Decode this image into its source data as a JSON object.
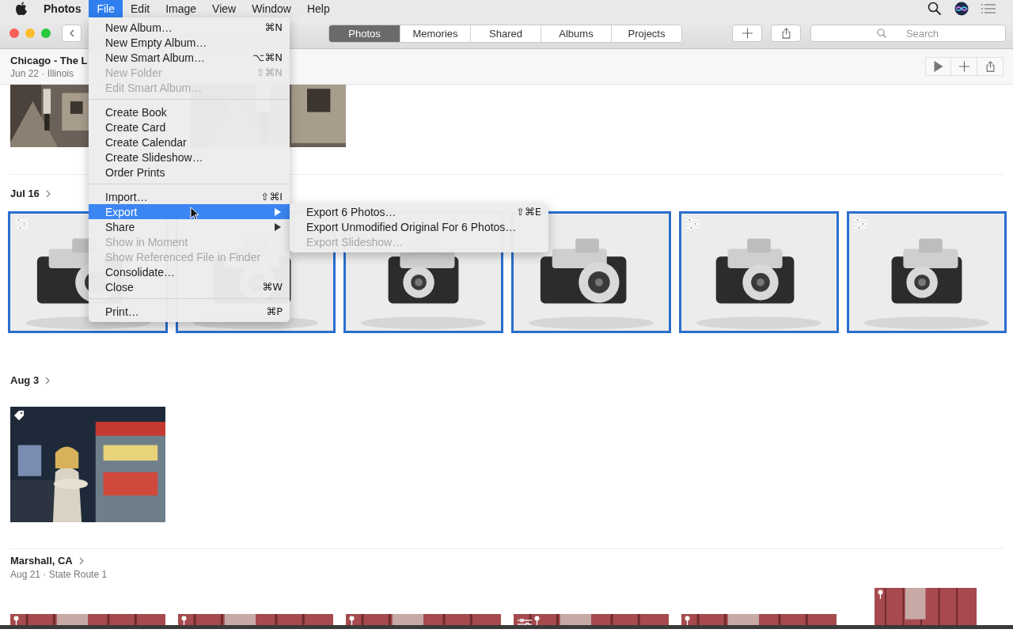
{
  "menu_bar": {
    "app_name": "Photos",
    "menus": [
      {
        "label": "File",
        "selected": true
      },
      {
        "label": "Edit",
        "selected": false
      },
      {
        "label": "Image",
        "selected": false
      },
      {
        "label": "View",
        "selected": false
      },
      {
        "label": "Window",
        "selected": false
      },
      {
        "label": "Help",
        "selected": false
      }
    ]
  },
  "toolbar": {
    "tabs": [
      {
        "label": "Photos",
        "selected": true
      },
      {
        "label": "Memories",
        "selected": false
      },
      {
        "label": "Shared",
        "selected": false
      },
      {
        "label": "Albums",
        "selected": false
      },
      {
        "label": "Projects",
        "selected": false
      }
    ],
    "search": {
      "placeholder": "Search"
    }
  },
  "header": {
    "title": "Chicago - The L",
    "subtitle": "Jun 22 · Illinois"
  },
  "top_strip": {
    "photos": [
      {
        "kind": "street",
        "selected": false
      },
      {
        "kind": "street",
        "selected": false
      }
    ]
  },
  "moments": [
    {
      "title": "Jul 16",
      "photos": [
        {
          "kind": "camera",
          "selected": true,
          "adjusted": true,
          "tagged": false,
          "pinned": false
        },
        {
          "kind": "camera",
          "selected": true,
          "adjusted": false,
          "tagged": false,
          "pinned": false
        },
        {
          "kind": "camera",
          "selected": true,
          "adjusted": false,
          "tagged": false,
          "pinned": false
        },
        {
          "kind": "camera",
          "selected": true,
          "adjusted": false,
          "tagged": false,
          "pinned": false
        },
        {
          "kind": "camera",
          "selected": true,
          "adjusted": true,
          "tagged": false,
          "pinned": false
        },
        {
          "kind": "camera",
          "selected": true,
          "adjusted": true,
          "tagged": false,
          "pinned": false
        }
      ]
    },
    {
      "title": "Aug 3",
      "photos": [
        {
          "kind": "market",
          "selected": false,
          "adjusted": false,
          "tagged": true,
          "pinned": false
        }
      ]
    },
    {
      "title": "Marshall, CA",
      "subtitle": "Aug 21 · State Route 1",
      "photos": [
        {
          "kind": "barn",
          "selected": false,
          "adjusted": false,
          "tagged": false,
          "pinned": true
        },
        {
          "kind": "barn",
          "selected": false,
          "adjusted": false,
          "tagged": false,
          "pinned": true
        },
        {
          "kind": "barn",
          "selected": false,
          "adjusted": false,
          "tagged": false,
          "pinned": true
        },
        {
          "kind": "barn",
          "selected": false,
          "adjusted": true,
          "tagged": false,
          "pinned": true
        },
        {
          "kind": "barn",
          "selected": false,
          "adjusted": false,
          "tagged": false,
          "pinned": true
        },
        {
          "kind": "barn",
          "selected": false,
          "adjusted": false,
          "tagged": false,
          "pinned": true
        }
      ]
    }
  ],
  "file_menu": {
    "items": [
      {
        "kind": "item",
        "label": "New Album…",
        "shortcut": "⌘N",
        "disabled": false,
        "selected": false
      },
      {
        "kind": "item",
        "label": "New Empty Album…",
        "disabled": false,
        "selected": false
      },
      {
        "kind": "item",
        "label": "New Smart Album…",
        "shortcut": "⌥⌘N",
        "disabled": false,
        "selected": false
      },
      {
        "kind": "item",
        "label": "New Folder",
        "shortcut": "⇧⌘N",
        "disabled": true,
        "selected": false
      },
      {
        "kind": "item",
        "label": "Edit Smart Album…",
        "disabled": true,
        "selected": false
      },
      {
        "kind": "separator"
      },
      {
        "kind": "item",
        "label": "Create Book",
        "disabled": false,
        "selected": false
      },
      {
        "kind": "item",
        "label": "Create Card",
        "disabled": false,
        "selected": false
      },
      {
        "kind": "item",
        "label": "Create Calendar",
        "disabled": false,
        "selected": false
      },
      {
        "kind": "item",
        "label": "Create Slideshow…",
        "disabled": false,
        "selected": false
      },
      {
        "kind": "item",
        "label": "Order Prints",
        "disabled": false,
        "selected": false
      },
      {
        "kind": "separator"
      },
      {
        "kind": "item",
        "label": "Import…",
        "shortcut": "⇧⌘I",
        "disabled": false,
        "selected": false
      },
      {
        "kind": "submenu",
        "label": "Export",
        "disabled": false,
        "selected": true
      },
      {
        "kind": "submenu",
        "label": "Share",
        "disabled": false,
        "selected": false
      },
      {
        "kind": "item",
        "label": "Show in Moment",
        "disabled": true,
        "selected": false
      },
      {
        "kind": "item",
        "label": "Show Referenced File in Finder",
        "disabled": true,
        "selected": false
      },
      {
        "kind": "item",
        "label": "Consolidate…",
        "disabled": false,
        "selected": false
      },
      {
        "kind": "item",
        "label": "Close",
        "shortcut": "⌘W",
        "disabled": false,
        "selected": false
      },
      {
        "kind": "separator"
      },
      {
        "kind": "item",
        "label": "Print…",
        "shortcut": "⌘P",
        "disabled": false,
        "selected": false
      }
    ]
  },
  "export_submenu": {
    "items": [
      {
        "kind": "item",
        "label": "Export 6 Photos…",
        "shortcut": "⇧⌘E",
        "disabled": false,
        "selected": false
      },
      {
        "kind": "item",
        "label": "Export Unmodified Original For 6 Photos…",
        "disabled": false,
        "selected": false
      },
      {
        "kind": "item",
        "label": "Export Slideshow…",
        "disabled": true,
        "selected": false
      }
    ]
  }
}
